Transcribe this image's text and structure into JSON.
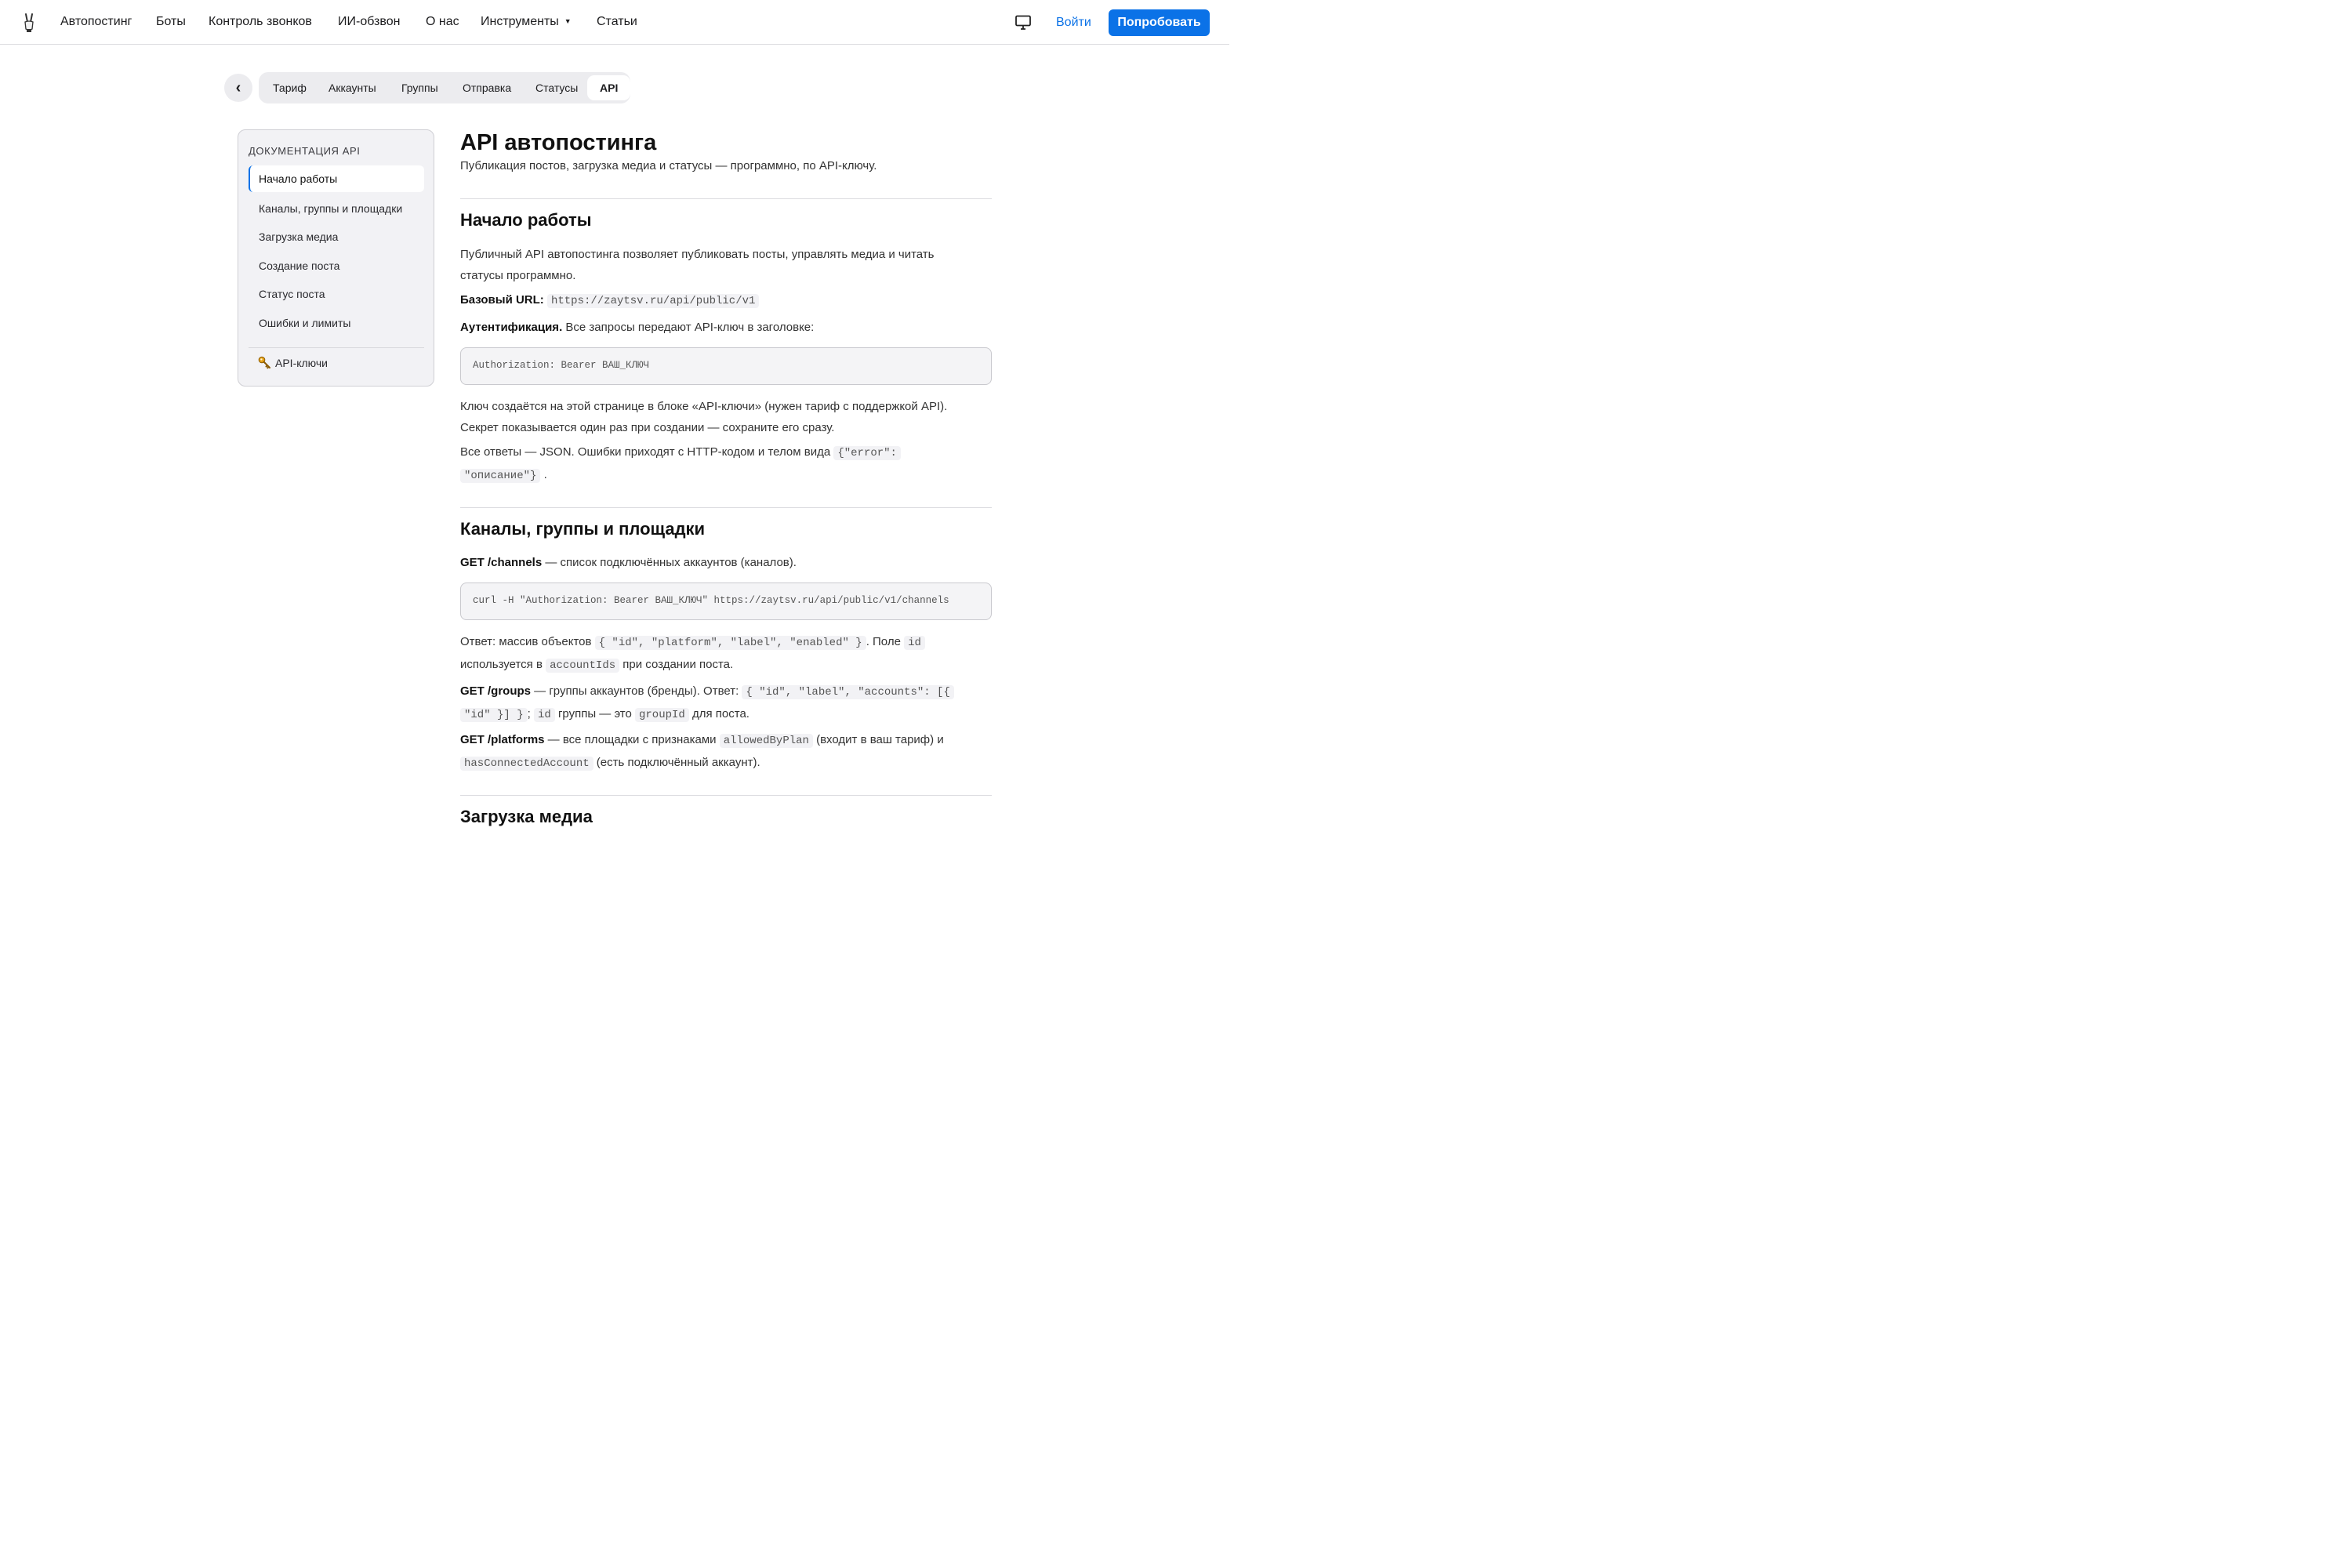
{
  "nav": {
    "items": [
      "Автопостинг",
      "Боты",
      "Контроль звонков",
      "ИИ-обзвон",
      "О нас",
      "Инструменты",
      "Статьи"
    ],
    "tools_caret": "▼",
    "login": "Войти",
    "try": "Попробовать"
  },
  "tabs": {
    "back": "‹",
    "items": [
      "Тариф",
      "Аккаунты",
      "Группы",
      "Отправка",
      "Статусы",
      "API"
    ],
    "active": "API"
  },
  "sidebar": {
    "title": "Документация API",
    "items": [
      "Начало работы",
      "Каналы, группы и площадки",
      "Загрузка медиа",
      "Создание поста",
      "Статус поста",
      "Ошибки и лимиты"
    ],
    "active": "Начало работы",
    "keys": "API-ключи"
  },
  "main": {
    "title": "API автопостинга",
    "lead": "Публикация постов, загрузка медиа и статусы — программно, по API-ключу.",
    "start": {
      "heading": "Начало работы",
      "intro_1": "Публичный API автопостинга позволяет публиковать посты, управлять медиа и читать",
      "intro_2": "статусы программно.",
      "base_label": "Базовый URL:",
      "base_url": "https://zaytsv.ru/api/public/v1",
      "auth_label": "Аутентификация.",
      "auth_text": " Все запросы передают API-ключ в заголовке:",
      "auth_code": "Authorization: Bearer ВАШ_КЛЮЧ",
      "key_1": "Ключ создаётся на этой странице в блоке «API-ключи» (нужен тариф с поддержкой API).",
      "key_2": "Секрет показывается один раз при создании — сохраните его сразу.",
      "json_text": "Все ответы — JSON. Ошибки приходят с HTTP-кодом и телом вида ",
      "json_code_1": "{\"error\":",
      "json_code_2": "\"описание\"}",
      "json_end": "."
    },
    "channels": {
      "heading": "Каналы, группы и площадки",
      "get_channels": "GET /channels",
      "get_channels_text": " — список подключённых аккаунтов (каналов).",
      "curl": "curl -H \"Authorization: Bearer ВАШ_КЛЮЧ\" https://zaytsv.ru/api/public/v1/channels",
      "resp_text": "Ответ: массив объектов ",
      "resp_code": "{ \"id\", \"platform\", \"label\", \"enabled\" }",
      "resp_text_2": ". Поле ",
      "resp_id": "id",
      "resp_text_3": "используется в ",
      "resp_accountids": "accountIds",
      "resp_text_4": " при создании поста.",
      "get_groups": "GET /groups",
      "groups_text": " — группы аккаунтов (бренды). Ответ: ",
      "groups_code_1": "{ \"id\", \"label\", \"accounts\": [{",
      "groups_code_2": "\"id\" }] }",
      "groups_sep": ";",
      "groups_id": "id",
      "groups_text_2": " группы — это ",
      "groups_groupid": "groupId",
      "groups_text_3": " для поста.",
      "get_platforms": "GET /platforms",
      "platforms_text": " — все площадки с признаками ",
      "platforms_code_1": "allowedByPlan",
      "platforms_text_2": " (входит в ваш тариф) и",
      "platforms_code_2": "hasConnectedAccount",
      "platforms_text_3": " (есть подключённый аккаунт)."
    },
    "media_heading": "Загрузка медиа"
  }
}
